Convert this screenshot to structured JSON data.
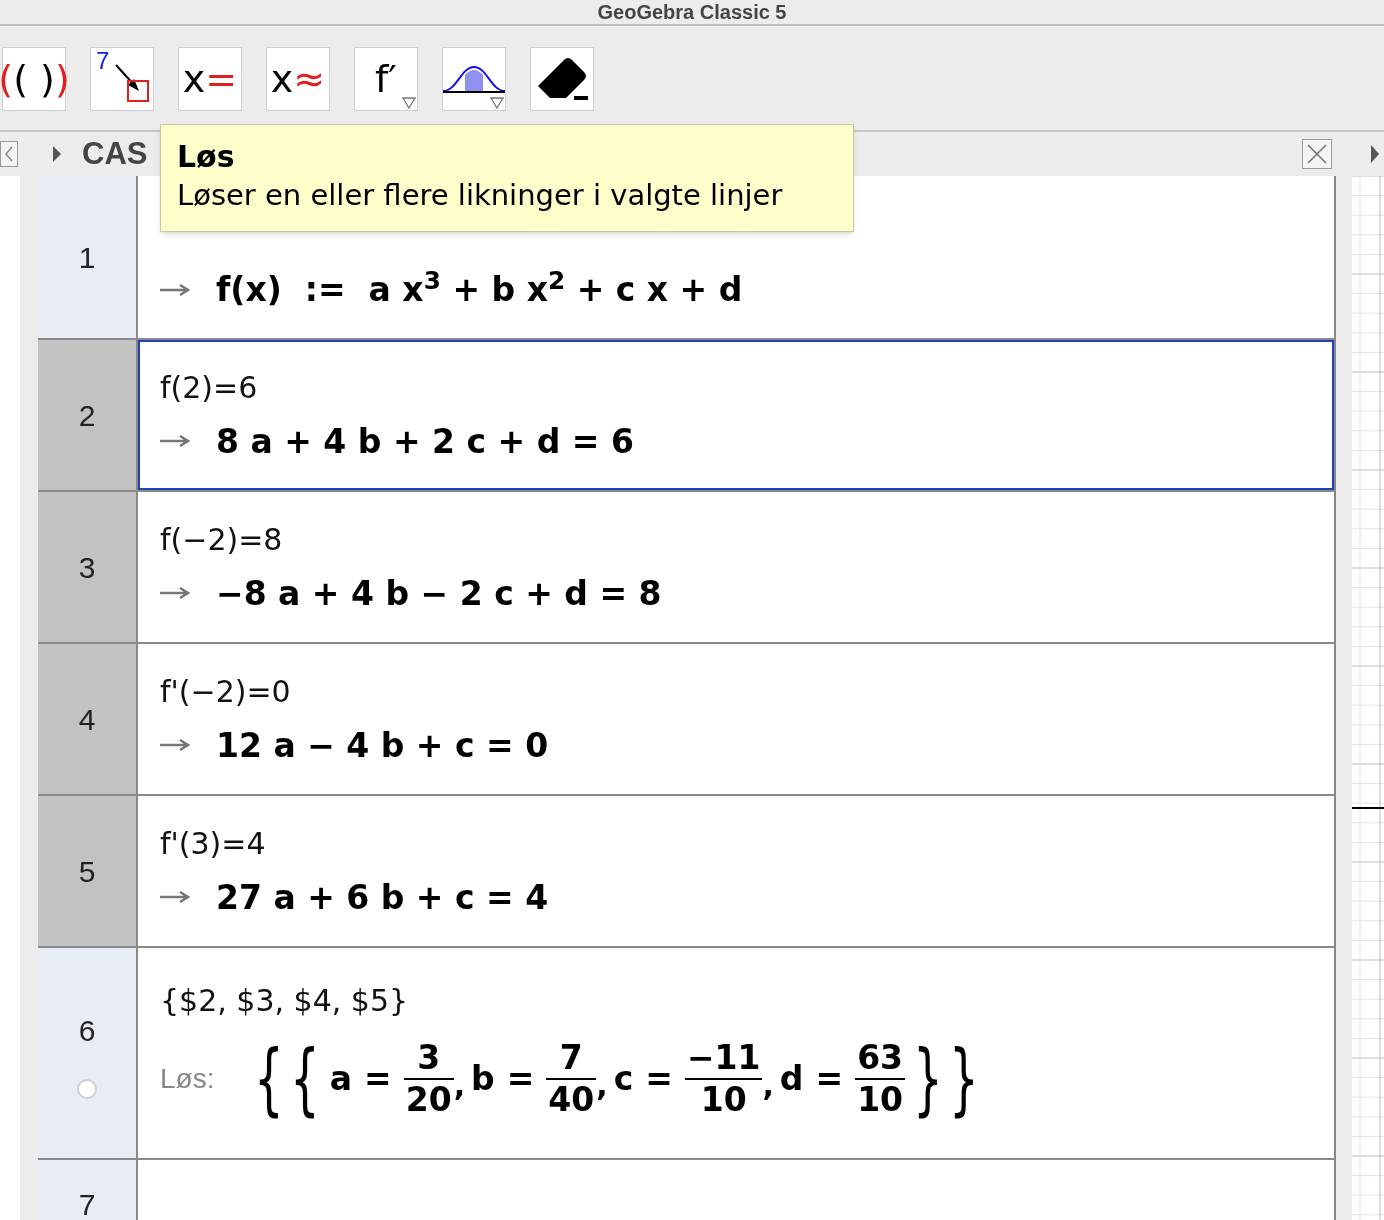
{
  "window": {
    "title": "GeoGebra Classic 5"
  },
  "toolbar": [
    {
      "kind": "text",
      "has_menu": false,
      "parts": [
        {
          "text": "(",
          "accent": true
        },
        {
          "text": "( )",
          "accent": false
        },
        {
          "text": ")",
          "accent": true
        }
      ]
    },
    {
      "kind": "numeric",
      "has_menu": false,
      "label": "7"
    },
    {
      "kind": "text",
      "has_menu": false,
      "parts": [
        {
          "text": "x",
          "accent": false
        },
        {
          "text": "=",
          "accent": true
        }
      ]
    },
    {
      "kind": "text",
      "has_menu": false,
      "parts": [
        {
          "text": "x",
          "accent": false
        },
        {
          "text": "≈",
          "accent": true
        }
      ]
    },
    {
      "kind": "text",
      "has_menu": true,
      "parts": [
        {
          "text": "f′",
          "accent": false
        }
      ]
    },
    {
      "kind": "normal",
      "has_menu": true
    },
    {
      "kind": "eraser",
      "has_menu": false
    }
  ],
  "panel": {
    "title": "CAS"
  },
  "tooltip": {
    "title": "Løs",
    "text": "Løser en eller flere likninger i valgte linjer"
  },
  "rows": [
    {
      "number": "1",
      "selected": false,
      "focused": false,
      "output": {
        "kind": "expr",
        "text": "f(x)  :=  a x$^{3}$ + b x$^{2}$ + c x + d"
      }
    },
    {
      "number": "2",
      "selected": true,
      "focused": true,
      "input": "f(2)=6",
      "output": {
        "kind": "expr",
        "text": "8 a + 4 b + 2 c + d = 6"
      }
    },
    {
      "number": "3",
      "selected": true,
      "focused": false,
      "input": "f(−2)=8",
      "output": {
        "kind": "expr",
        "text": "−8 a + 4 b − 2 c + d = 8"
      }
    },
    {
      "number": "4",
      "selected": true,
      "focused": false,
      "input": "f'(−2)=0",
      "output": {
        "kind": "expr",
        "text": "12 a − 4 b + c = 0"
      }
    },
    {
      "number": "5",
      "selected": true,
      "focused": false,
      "input": "f'(3)=4",
      "output": {
        "kind": "expr",
        "text": "27 a + 6 b + c = 4"
      }
    },
    {
      "number": "6",
      "selected": false,
      "focused": false,
      "visible": false,
      "input": "{$2, $3, $4, $5}",
      "output": {
        "kind": "solution",
        "label": "Løs:",
        "open": "{",
        "close": "}",
        "separator": ",",
        "terms": [
          {
            "name": "a",
            "sign": "=",
            "num": "3",
            "den": "20"
          },
          {
            "name": "b",
            "sign": "=",
            "num": "7",
            "den": "40"
          },
          {
            "name": "c",
            "sign": "=",
            "num": "−11",
            "den": "10"
          },
          {
            "name": "d",
            "sign": "=",
            "num": "63",
            "den": "10"
          }
        ]
      }
    },
    {
      "number": "7",
      "selected": false,
      "focused": false
    }
  ]
}
